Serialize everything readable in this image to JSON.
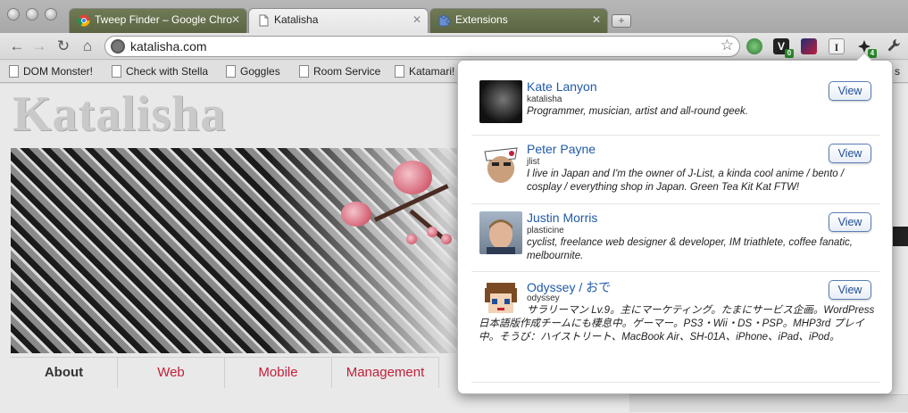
{
  "browser": {
    "tabs": [
      {
        "title": "Tweep Finder – Google Chro",
        "state": "inactive",
        "icon": "chrome-icon"
      },
      {
        "title": "Katalisha",
        "state": "active",
        "icon": "page-icon"
      },
      {
        "title": "Extensions",
        "state": "inactive",
        "icon": "puzzle-icon"
      }
    ],
    "new_tab_symbol": "+",
    "close_symbol": "✕",
    "back_symbol": "←",
    "forward_symbol": "→",
    "reload_symbol": "↻",
    "home_symbol": "⌂",
    "url": "katalisha.com",
    "bookmark_star": "☆",
    "extensions": [
      {
        "name": "green-extension-icon",
        "glyph": "●",
        "badge": ""
      },
      {
        "name": "v-extension-icon",
        "glyph": "V",
        "badge": "0"
      },
      {
        "name": "blue-extension-icon",
        "glyph": "▰",
        "badge": ""
      },
      {
        "name": "i-extension-icon",
        "glyph": "I",
        "badge": ""
      },
      {
        "name": "tweep-finder-bird-icon",
        "glyph": "✦",
        "badge": "4"
      }
    ],
    "wrench_symbol": "🔧",
    "bookmarks": [
      "DOM Monster!",
      "Check with Stella",
      "Goggles",
      "Room Service",
      "Katamari!",
      "s"
    ]
  },
  "page": {
    "site_title": "Katalisha",
    "nav": [
      "About",
      "Web",
      "Mobile",
      "Management"
    ],
    "right_link_fragment": "t"
  },
  "popup": {
    "view_label": "View",
    "results": [
      {
        "name": "Kate Lanyon",
        "handle": "katalisha",
        "bio": "Programmer, musician, artist and all-round geek."
      },
      {
        "name": "Peter Payne",
        "handle": "jlist",
        "bio": "I live in Japan and I'm the owner of J-List, a kinda cool anime / bento / cosplay / everything shop in Japan. Green Tea Kit Kat FTW!"
      },
      {
        "name": "Justin Morris",
        "handle": "plasticine",
        "bio": "cyclist, freelance web designer & developer, IM triathlete, coffee fanatic, melbournite."
      },
      {
        "name": "Odyssey / おで",
        "handle": "odyssey",
        "bio": "サラリーマン Lv.9。主にマーケティング。たまにサービス企画。WordPress 日本語版作成チームにも棲息中。ゲーマー。PS3・Wii・DS・PSP。MHP3rd プレイ中。そうび：ハイストリート、MacBook Air、SH-01A、iPhone、iPad、iPod。"
      }
    ]
  },
  "colors": {
    "link_blue": "#1f5aa8",
    "accent_red": "#c2203a",
    "inactive_tab": "#5b6544"
  }
}
